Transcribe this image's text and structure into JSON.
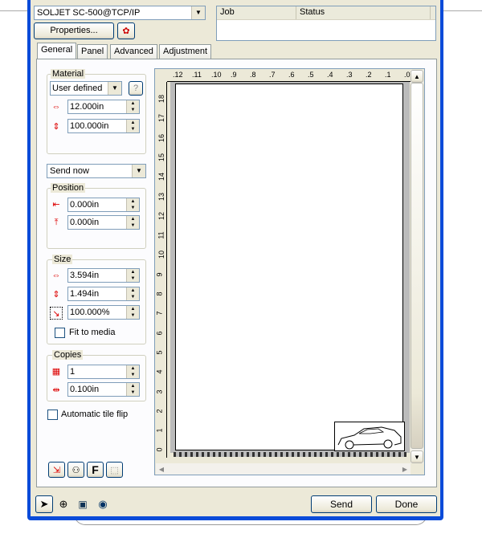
{
  "printer": {
    "name": "SOLJET SC-500@TCP/IP",
    "properties_label": "Properties..."
  },
  "queue": {
    "columns": [
      "Job",
      "Status"
    ]
  },
  "tabs": [
    "General",
    "Panel",
    "Advanced",
    "Adjustment"
  ],
  "material": {
    "label": "Material",
    "type": "User defined",
    "width": "12.000in",
    "height": "100.000in"
  },
  "send_mode": "Send now",
  "position": {
    "label": "Position",
    "x": "0.000in",
    "y": "0.000in"
  },
  "size": {
    "label": "Size",
    "width": "3.594in",
    "height": "1.494in",
    "scale": "100.000%",
    "fit_label": "Fit to media"
  },
  "copies": {
    "label": "Copies",
    "count": "1",
    "spacing": "0.100in"
  },
  "auto_tile_label": "Automatic tile flip",
  "ruler": {
    "top": [
      ".12",
      ".11",
      ".10",
      ".9",
      ".8",
      ".7",
      ".6",
      ".5",
      ".4",
      ".3",
      ".2",
      ".1",
      ".0"
    ],
    "left": [
      "18",
      "17",
      "16",
      "15",
      "14",
      "13",
      "12",
      "11",
      "10",
      "9",
      "8",
      "7",
      "6",
      "5",
      "4",
      "3",
      "2",
      "1",
      "0"
    ]
  },
  "buttons": {
    "send": "Send",
    "done": "Done",
    "f_label": "F"
  },
  "icons": {
    "pointer": "pointer-icon",
    "zoom": "zoom-icon",
    "preview": "preview-icon",
    "zoom_fit": "zoom-fit-icon"
  }
}
